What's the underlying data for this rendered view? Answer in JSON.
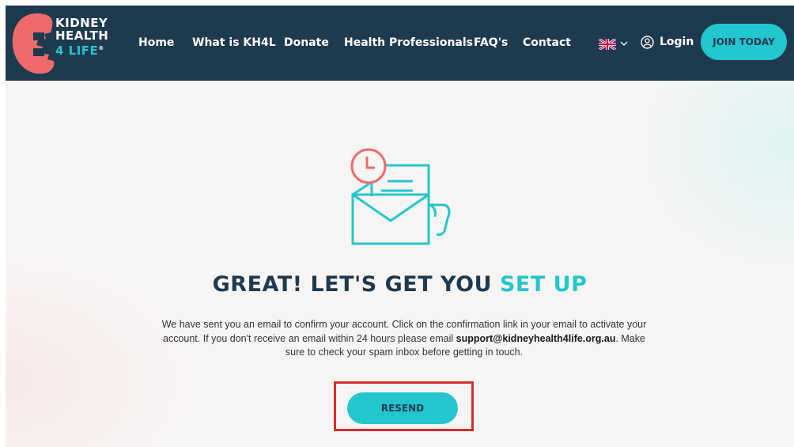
{
  "brand": {
    "logo_line1": "KIDNEY",
    "logo_line2": "HEALTH",
    "logo_line3_num": "4",
    "logo_line3_word": "LIFE",
    "logo_reg": "®"
  },
  "nav": {
    "items": [
      {
        "label": "Home"
      },
      {
        "label": "What is KH4L"
      },
      {
        "label": "Donate"
      },
      {
        "label": "Health Professionals"
      },
      {
        "label": "FAQ's"
      },
      {
        "label": "Contact"
      }
    ],
    "language_icon": "uk-flag-icon",
    "login_label": "Login",
    "join_label": "JOIN TODAY"
  },
  "colors": {
    "navy": "#1e3a4f",
    "teal": "#23c6cf",
    "coral": "#ef6b6b",
    "highlight": "#d62d2d"
  },
  "main": {
    "headline_part1": "GREAT! LET'S GET YOU",
    "headline_part2": "SET UP",
    "message_part1": "We have sent you an email to confirm your account. Click on the confirmation link in your email to activate your account. If you don't receive an email within 24 hours please email",
    "support_email": "support@kidneyhealth4life.org.au",
    "message_part2": ". Make sure to check your spam inbox before getting in touch.",
    "resend_label": "RESEND"
  }
}
